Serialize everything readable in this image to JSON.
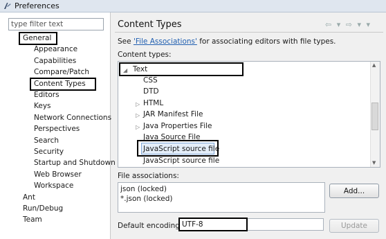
{
  "window": {
    "title": "Preferences"
  },
  "left": {
    "filter_placeholder": "type filter text",
    "tree": [
      {
        "label": "General",
        "indent": 0,
        "outlined": true
      },
      {
        "label": "Appearance",
        "indent": 1
      },
      {
        "label": "Capabilities",
        "indent": 1
      },
      {
        "label": "Compare/Patch",
        "indent": 1
      },
      {
        "label": "Content Types",
        "indent": 1,
        "outlined": true
      },
      {
        "label": "Editors",
        "indent": 1
      },
      {
        "label": "Keys",
        "indent": 1
      },
      {
        "label": "Network Connections",
        "indent": 1
      },
      {
        "label": "Perspectives",
        "indent": 1
      },
      {
        "label": "Search",
        "indent": 1
      },
      {
        "label": "Security",
        "indent": 1
      },
      {
        "label": "Startup and Shutdown",
        "indent": 1
      },
      {
        "label": "Web Browser",
        "indent": 1
      },
      {
        "label": "Workspace",
        "indent": 1
      },
      {
        "label": "Ant",
        "indent": 0
      },
      {
        "label": "Run/Debug",
        "indent": 0
      },
      {
        "label": "Team",
        "indent": 0
      }
    ]
  },
  "right": {
    "title": "Content Types",
    "nav_glyphs": "⇦ ▾ ⇨ ▾ ▾",
    "desc_prefix": "See ",
    "desc_link": "'File Associations'",
    "desc_suffix": " for associating editors with file types.",
    "content_types_label": "Content types:",
    "content_types": [
      {
        "label": "Text",
        "toggle": "◢",
        "level": 0
      },
      {
        "label": "CSS",
        "toggle": "",
        "level": 1
      },
      {
        "label": "DTD",
        "toggle": "",
        "level": 1
      },
      {
        "label": "HTML",
        "toggle": "▷",
        "level": 1
      },
      {
        "label": "JAR Manifest File",
        "toggle": "▷",
        "level": 1
      },
      {
        "label": "Java Properties File",
        "toggle": "▷",
        "level": 1
      },
      {
        "label": "Java Source File",
        "toggle": "",
        "level": 1
      },
      {
        "label": "JavaScript source file",
        "toggle": "",
        "level": 1,
        "selected": true
      },
      {
        "label": "JavaScript source file",
        "toggle": "",
        "level": 1
      }
    ],
    "file_assoc_label": "File associations:",
    "file_associations": [
      "json (locked)",
      "*.json (locked)"
    ],
    "add_button": "Add...",
    "encoding_label": "Default encoding:",
    "encoding_value": "UTF-8",
    "update_button": "Update"
  },
  "colors": {
    "selection": "#e4eef9",
    "link": "#1f5eb0",
    "highlight_box": "#000000"
  }
}
